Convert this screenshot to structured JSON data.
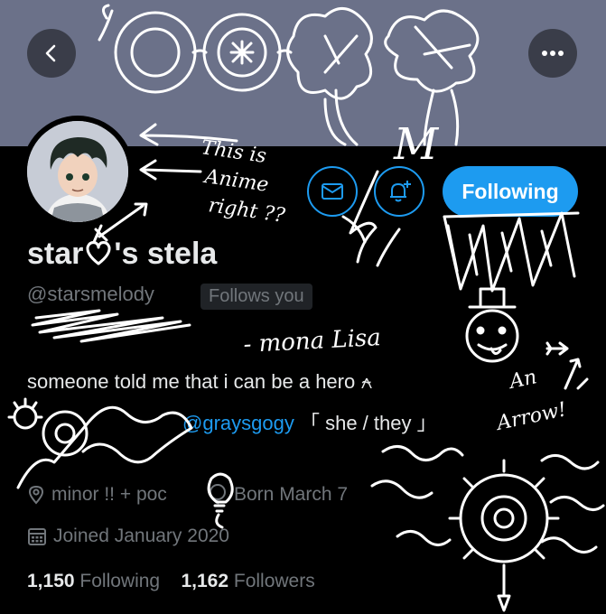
{
  "profile": {
    "name_pre": "star",
    "name_post": "'s stela",
    "handle": "@starsmelody",
    "follows_you": "Follows you",
    "bio_line1": "someone told me that i can be a hero ⍲",
    "bio_mention": "@graysgogy",
    "bio_pronouns": "「 she / they 」",
    "location": "minor !! + poc",
    "birthday": "Born March 7",
    "joined": "Joined January 2020"
  },
  "actions": {
    "follow_label": "Following"
  },
  "stats": {
    "following_count": "1,150",
    "following_label": "Following",
    "followers_count": "1,162",
    "followers_label": "Followers"
  },
  "doodle_text": {
    "note_anime": [
      "This is",
      "Anime",
      "right ??"
    ],
    "letter_m": "M",
    "signature": "- mona Lisa",
    "note_arrow": [
      "An",
      "Arrow!"
    ]
  },
  "icons": {
    "back": "back-arrow-icon",
    "more": "more-options-icon",
    "mail": "mail-icon",
    "notify": "bell-plus-icon",
    "location": "location-pin-icon",
    "birthday": "balloon-icon",
    "calendar": "calendar-icon"
  },
  "colors": {
    "accent": "#1d9bf0",
    "banner": "#6b7189",
    "background": "#000000",
    "muted": "#71767b"
  }
}
